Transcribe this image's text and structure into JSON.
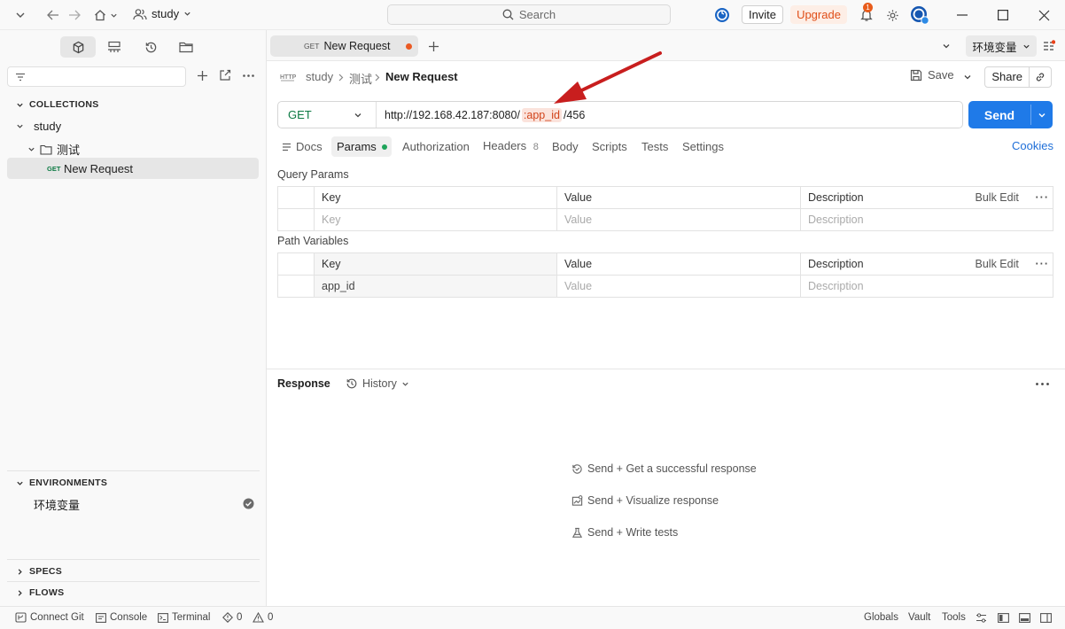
{
  "topbar": {
    "workspace": "study",
    "search_placeholder": "Search",
    "invite_label": "Invite",
    "upgrade_label": "Upgrade",
    "notification_count": "1"
  },
  "sidebar": {
    "collections_header": "COLLECTIONS",
    "tree": {
      "collection": "study",
      "folder": "测试",
      "request_method": "GET",
      "request_name": "New Request"
    },
    "environments_header": "ENVIRONMENTS",
    "environment_item": "环境变量",
    "specs_header": "SPECS",
    "flows_header": "FLOWS"
  },
  "tabs": {
    "active_tab_method": "GET",
    "active_tab_name": "New Request",
    "environment_selector": "环境变量"
  },
  "request": {
    "breadcrumb": [
      "study",
      "测试",
      "New Request"
    ],
    "save_label": "Save",
    "share_label": "Share",
    "method": "GET",
    "url_prefix": "http://192.168.42.187:8080/",
    "url_variable": ":app_id",
    "url_suffix": "/456",
    "send_label": "Send",
    "tabs": [
      "Docs",
      "Params",
      "Authorization",
      "Headers",
      "Body",
      "Scripts",
      "Tests",
      "Settings"
    ],
    "headers_count": "8",
    "cookies_label": "Cookies"
  },
  "query_params": {
    "title": "Query Params",
    "columns": [
      "Key",
      "Value",
      "Description"
    ],
    "bulk_edit": "Bulk Edit",
    "placeholder_row": {
      "key": "Key",
      "value": "Value",
      "description": "Description"
    }
  },
  "path_variables": {
    "title": "Path Variables",
    "columns": [
      "Key",
      "Value",
      "Description"
    ],
    "bulk_edit": "Bulk Edit",
    "rows": [
      {
        "key": "app_id",
        "value": "Value",
        "description": "Description"
      }
    ]
  },
  "response": {
    "title": "Response",
    "history_label": "History",
    "hints": [
      "Send + Get a successful response",
      "Send + Visualize response",
      "Send + Write tests"
    ]
  },
  "statusbar": {
    "connect_git": "Connect Git",
    "console": "Console",
    "terminal": "Terminal",
    "errors_count": "0",
    "warnings_count": "0",
    "globals": "Globals",
    "vault": "Vault",
    "tools": "Tools"
  },
  "colors": {
    "accent": "#1f7ae8",
    "get_method": "#0c7a43",
    "variable": "#d2441b",
    "upgrade": "#e04e18"
  }
}
